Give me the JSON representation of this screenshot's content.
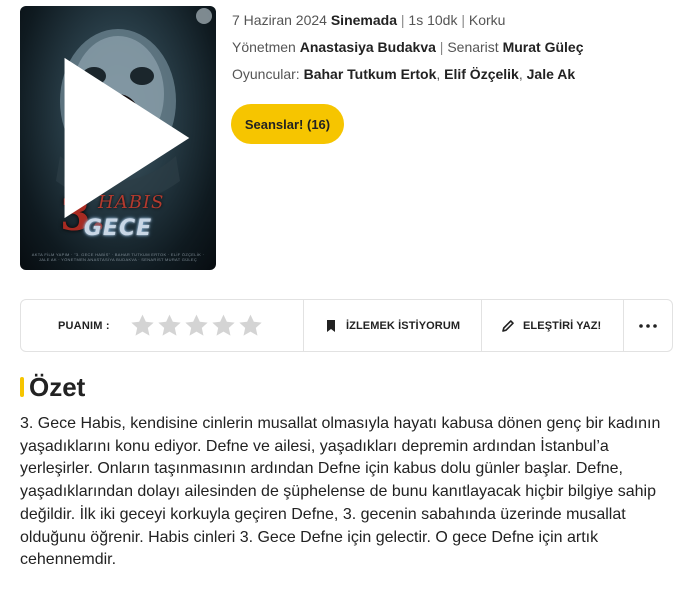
{
  "poster": {
    "title_number": "3.",
    "title_top": "HABIS",
    "title_main": "GECE",
    "credits": "AKTA FİLM YAPIM · \"3. GECE HABİS\" · BAHAR TUTKUM ERTOK · ELİF ÖZÇELİK · JALE AK · YÖNETMEN ANASTASİYA BUDAKVA · SENARİST MURAT GÜLEÇ"
  },
  "movie": {
    "date": "7 Haziran 2024",
    "status": "Sinemada",
    "duration": "1s 10dk",
    "genre": "Korku",
    "director_label": "Yönetmen",
    "director": "Anastasiya Budakva",
    "writer_label": "Senarist",
    "writer": "Murat Güleç",
    "cast_label": "Oyuncular:",
    "cast": [
      "Bahar Tutkum Ertok",
      "Elif Özçelik",
      "Jale Ak"
    ]
  },
  "seans_button": "Seanslar! (16)",
  "actions": {
    "rating_label": "PUANIM :",
    "rating_value": 0,
    "rating_max": 5,
    "watchlist_label": "İZLEMEK İSTİYORUM",
    "critic_label": "ELEŞTİRİ YAZ!",
    "more_label": "•••"
  },
  "summary": {
    "heading": "Özet",
    "text": "3. Gece Habis, kendisine cinlerin musallat olmasıyla hayatı kabusa dönen genç bir kadının yaşadıklarını konu ediyor. Defne ve ailesi, yaşadıkları depremin ardından İstanbul’a yerleşirler. Onların taşınmasının ardından Defne için kabus dolu günler başlar. Defne, yaşadıklarından dolayı ailesinden de şüphelense de bunu kanıtlayacak hiçbir bilgiye sahip değildir. İlk iki geceyi korkuyla geçiren Defne, 3. gecenin sabahında üzerinde musallat olduğunu öğrenir. Habis cinleri 3. Gece Defne için gelectir. O gece Defne için artık cehennemdir."
  },
  "colors": {
    "accent": "#f6c500",
    "star_empty": "#d4d4d4",
    "border": "#e2e2e2"
  }
}
